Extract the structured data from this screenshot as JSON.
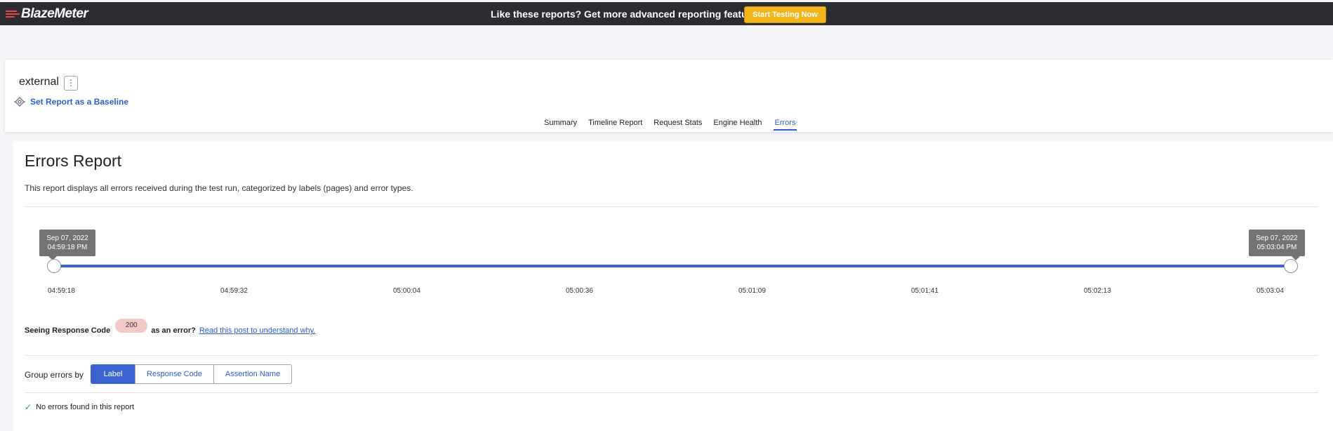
{
  "topbar": {
    "logo": "BlazeMeter",
    "promo_text": "Like these reports? Get more advanced reporting features",
    "start_button": "Start Testing Now"
  },
  "header": {
    "report_name": "external",
    "kebab": "⋮",
    "baseline_link": "Set Report as a Baseline",
    "tabs": [
      {
        "label": "Summary"
      },
      {
        "label": "Timeline Report"
      },
      {
        "label": "Request Stats"
      },
      {
        "label": "Engine Health"
      },
      {
        "label": "Errors",
        "active": true
      }
    ]
  },
  "main": {
    "title": "Errors Report",
    "description": "This report displays all errors received during the test run, categorized by labels (pages) and error types.",
    "slider": {
      "start": {
        "date": "Sep 07, 2022",
        "time": "04:59:18 PM"
      },
      "end": {
        "date": "Sep 07, 2022",
        "time": "05:03:04 PM"
      },
      "ticks": [
        "04:59:18",
        "04:59:32",
        "05:00:04",
        "05:00:36",
        "05:01:09",
        "05:01:41",
        "05:02:13",
        "05:03:04"
      ]
    },
    "response_code": {
      "prefix": "Seeing Response Code",
      "code": "200",
      "suffix": "as an error?",
      "link": "Read this post to understand why."
    },
    "group": {
      "label": "Group errors by",
      "options": [
        "Label",
        "Response Code",
        "Assertion Name"
      ],
      "selected": "Label"
    },
    "no_errors": "No errors found in this report"
  },
  "colors": {
    "accent": "#3b63d1",
    "cta": "#f2b51b",
    "topbar": "#2b2d33",
    "badge": "#f3c9c6",
    "success": "#3a9a4a"
  }
}
